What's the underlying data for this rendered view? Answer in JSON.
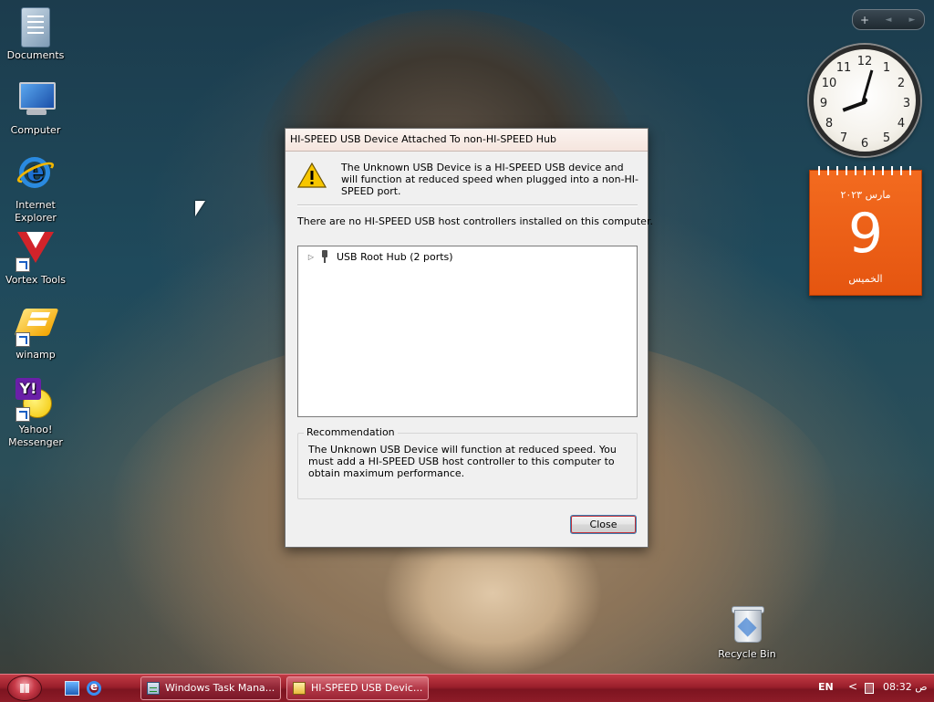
{
  "desktop": {
    "icons": [
      {
        "label": "Documents"
      },
      {
        "label": "Computer"
      },
      {
        "label": "Internet Explorer"
      },
      {
        "label": "Vortex Tools"
      },
      {
        "label": "winamp"
      },
      {
        "label": "Yahoo! Messenger"
      },
      {
        "label": "Recycle Bin"
      }
    ]
  },
  "sidebar": {
    "add_label": "+",
    "prev_label": "◄",
    "next_label": "►",
    "clock": {
      "numbers": [
        "12",
        "1",
        "2",
        "3",
        "4",
        "5",
        "6",
        "7",
        "8",
        "9",
        "10",
        "11"
      ],
      "time": "08:32"
    },
    "calendar": {
      "month": "مارس ٢٠٢٣",
      "day": "9",
      "weekday": "الخميس"
    }
  },
  "dialog": {
    "title": "HI-SPEED USB Device Attached To non-HI-SPEED Hub",
    "warning_message": "The Unknown USB Device is a HI-SPEED USB device and will function at reduced speed when plugged into a non-HI-SPEED port.",
    "no_controllers_text": "There are no HI-SPEED USB host controllers installed on this computer.",
    "tree": {
      "items": [
        {
          "label": "USB Root Hub (2 ports)",
          "expander": "▷"
        }
      ]
    },
    "recommendation": {
      "legend": "Recommendation",
      "text": "The Unknown USB Device will function at reduced speed. You must add a HI-SPEED USB host controller to this computer to obtain maximum performance."
    },
    "close_label": "Close"
  },
  "taskbar": {
    "buttons": [
      {
        "label": "Windows Task Mana...",
        "active": false
      },
      {
        "label": "HI-SPEED USB Devic...",
        "active": true
      }
    ],
    "tray": {
      "language": "EN",
      "arrow": "<",
      "clock": "ص 08:32"
    }
  },
  "colors": {
    "taskbar": "#9a1f2b",
    "calendar": "#e55510",
    "dialog_bg": "#f0f0f0"
  }
}
